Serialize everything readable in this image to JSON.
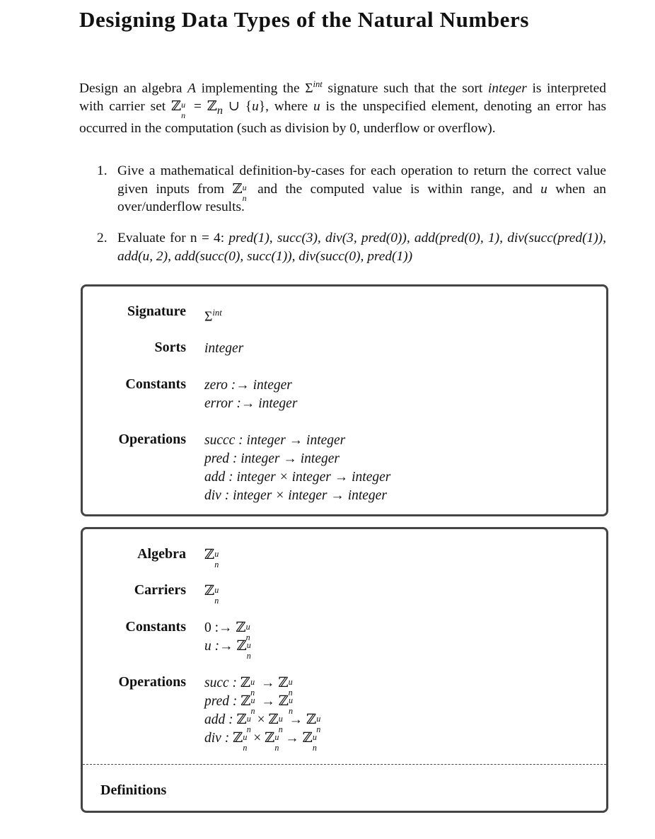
{
  "title": "Designing Data Types of the Natural Numbers",
  "intro": {
    "part1": "Design an algebra ",
    "A": "A",
    "part2": " implementing the ",
    "sigma": "Σ",
    "sigma_sup": "int",
    "part3": " signature such that the sort ",
    "sort": "integer",
    "part4": " is interpreted with carrier set ",
    "carrier_expr": "ℤ",
    "part5": " = ℤ",
    "part5b": " ∪ {",
    "u": "u",
    "part6": "}, where ",
    "part7": " is the unspecified element, denoting an error has occurred in the computation (such as division by 0, underflow or overflow)."
  },
  "tasks": [
    {
      "num": "1.",
      "text_a": "Give a mathematical definition-by-cases for each operation to return the correct value given inputs from ",
      "text_b": " and the computed value is within range, and ",
      "text_c": " when an over/underflow results."
    },
    {
      "num": "2.",
      "text": "Evaluate for n = 4: ",
      "expressions": "pred(1), succ(3), div(3, pred(0)), add(pred(0), 1), div(succ(pred(1)), add(u, 2), add(succ(0), succ(1)), div(succ(0), pred(1))"
    }
  ],
  "signature_box": {
    "rows": [
      {
        "label": "Signature",
        "values": [
          "Σ"
        ],
        "sup": "int"
      },
      {
        "label": "Sorts",
        "values": [
          "integer"
        ]
      },
      {
        "label": "Constants",
        "values": [
          "zero :→ integer",
          "error :→ integer"
        ]
      },
      {
        "label": "Operations",
        "values": [
          "succc : integer → integer",
          "pred : integer → integer",
          "add : integer × integer → integer",
          "div : integer × integer → integer"
        ]
      }
    ]
  },
  "algebra_box": {
    "rows": [
      {
        "label": "Algebra",
        "values": [
          "ℤ"
        ]
      },
      {
        "label": "Carriers",
        "values": [
          "ℤ"
        ]
      },
      {
        "label": "Constants",
        "values": [
          "0 :→",
          "u :→"
        ]
      },
      {
        "label": "Operations",
        "values": [
          "succ :",
          "pred :",
          "add :",
          "div :"
        ]
      }
    ],
    "definitions_label": "Definitions"
  },
  "symbols": {
    "Z": "ℤ",
    "sup_u": "u",
    "sub_n": "n",
    "arrow": "→",
    "times": "×",
    "colon_arrow": ":→",
    "colon": ":"
  }
}
